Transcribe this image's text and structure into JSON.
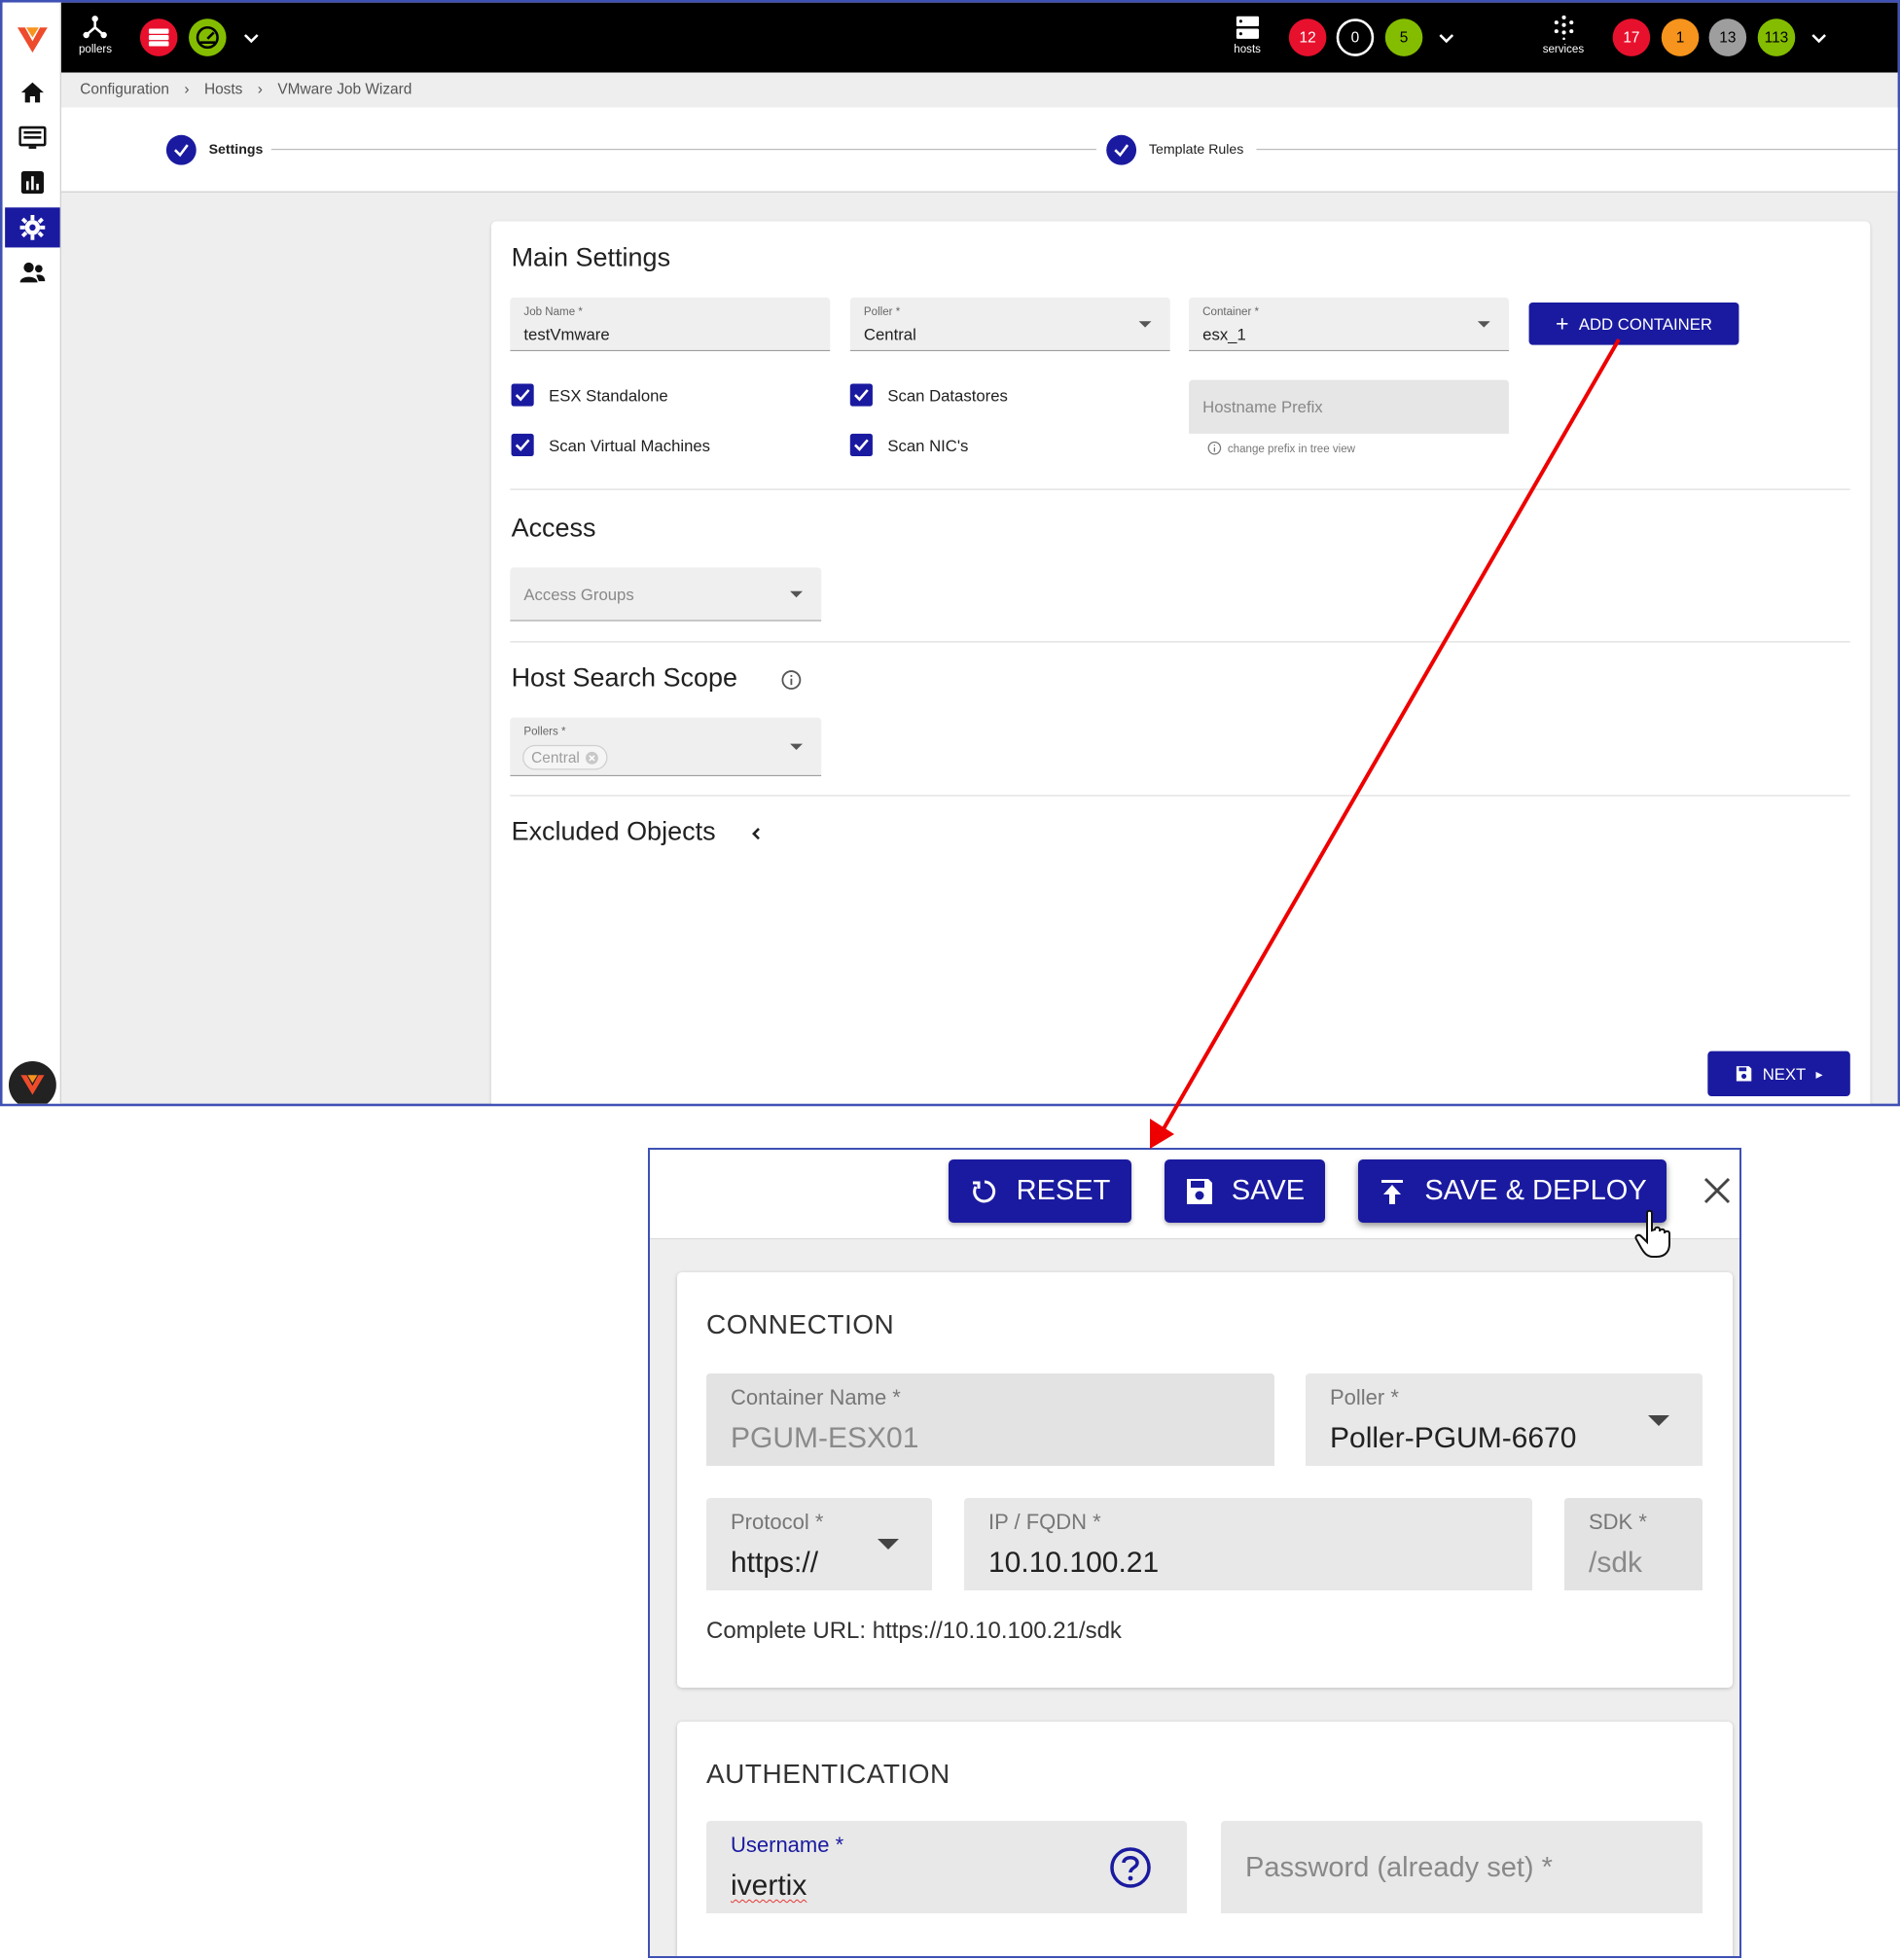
{
  "topbar": {
    "pollers_label": "pollers",
    "hosts_label": "hosts",
    "services_label": "services",
    "hosts_counts": [
      "12",
      "0",
      "5"
    ],
    "services_counts": [
      "17",
      "1",
      "13",
      "113"
    ]
  },
  "breadcrumb": [
    "Configuration",
    "Hosts",
    "VMware Job Wizard"
  ],
  "stepper": [
    "Settings",
    "Template Rules"
  ],
  "main_settings": {
    "title": "Main Settings",
    "job_name_label": "Job Name *",
    "job_name_value": "testVmware",
    "poller_label": "Poller *",
    "poller_value": "Central",
    "container_label": "Container *",
    "container_value": "esx_1",
    "add_container_label": "ADD CONTAINER",
    "checkboxes": [
      "ESX Standalone",
      "Scan Datastores",
      "Scan Virtual Machines",
      "Scan NIC's"
    ],
    "hostname_prefix_placeholder": "Hostname Prefix",
    "hostname_hint": "change prefix in tree view"
  },
  "access": {
    "title": "Access",
    "access_groups_placeholder": "Access Groups"
  },
  "host_search_scope": {
    "title": "Host Search Scope",
    "pollers_label": "Pollers *",
    "pollers_chip": "Central"
  },
  "excluded_objects": {
    "title": "Excluded Objects"
  },
  "next_label": "NEXT",
  "dialog": {
    "reset_label": "RESET",
    "save_label": "SAVE",
    "save_deploy_label": "SAVE & DEPLOY",
    "connection": {
      "title": "CONNECTION",
      "container_name_label": "Container Name *",
      "container_name_value": "PGUM-ESX01",
      "poller_label": "Poller *",
      "poller_value": "Poller-PGUM-6670",
      "protocol_label": "Protocol *",
      "protocol_value": "https://",
      "ip_label": "IP / FQDN *",
      "ip_value": "10.10.100.21",
      "sdk_label": "SDK *",
      "sdk_value": "/sdk",
      "complete_url": "Complete URL: https://10.10.100.21/sdk"
    },
    "authentication": {
      "title": "AUTHENTICATION",
      "username_label": "Username *",
      "username_value": "ivertix",
      "password_placeholder": "Password (already set) *"
    }
  },
  "colors": {
    "primary": "#1a1aa0",
    "red": "#e8112d",
    "green": "#84bd00",
    "orange": "#f7941d",
    "grey": "#9e9e9e",
    "arrow": "#ee0000"
  }
}
